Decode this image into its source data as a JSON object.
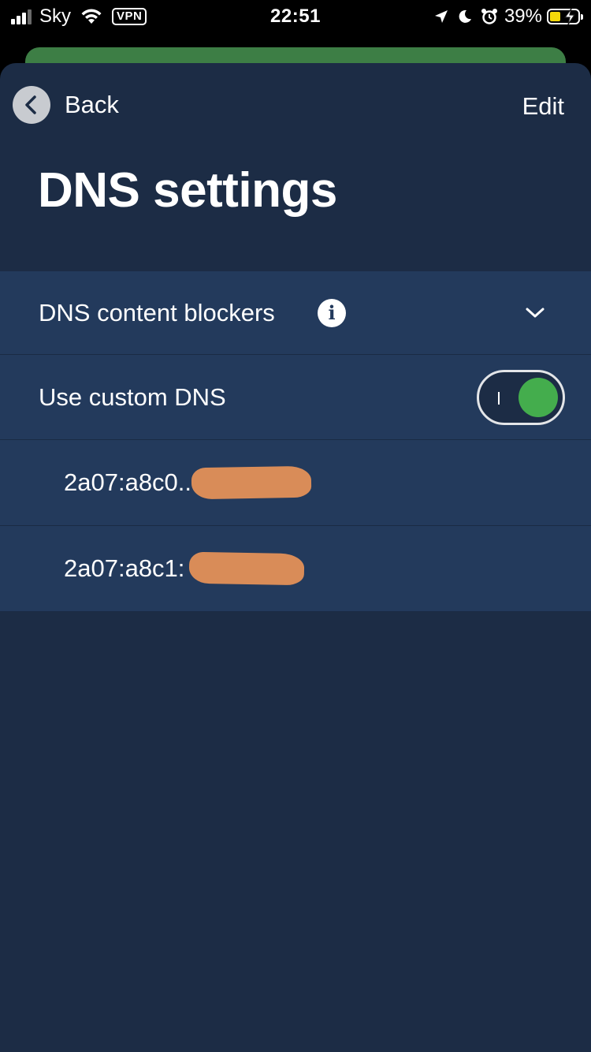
{
  "status_bar": {
    "carrier": "Sky",
    "vpn_label": "VPN",
    "time": "22:51",
    "battery_percent": "39%",
    "battery_level": 0.39,
    "battery_fill_color": "#f5d90a",
    "charging": true
  },
  "nav": {
    "back_label": "Back",
    "edit_label": "Edit"
  },
  "page": {
    "title": "DNS settings"
  },
  "settings": {
    "content_blockers_label": "DNS content blockers",
    "info_icon_glyph": "i",
    "custom_dns_label": "Use custom DNS",
    "custom_dns_enabled": true,
    "toggle_on_color": "#44ad4d",
    "dns_servers": [
      "2a07:a8c0...",
      "2a07:a8c1:"
    ]
  },
  "colors": {
    "sheet_background": "#1c2c45",
    "row_background": "#233a5c",
    "background_peek": "#3d7e45",
    "redaction": "#d98c58"
  }
}
